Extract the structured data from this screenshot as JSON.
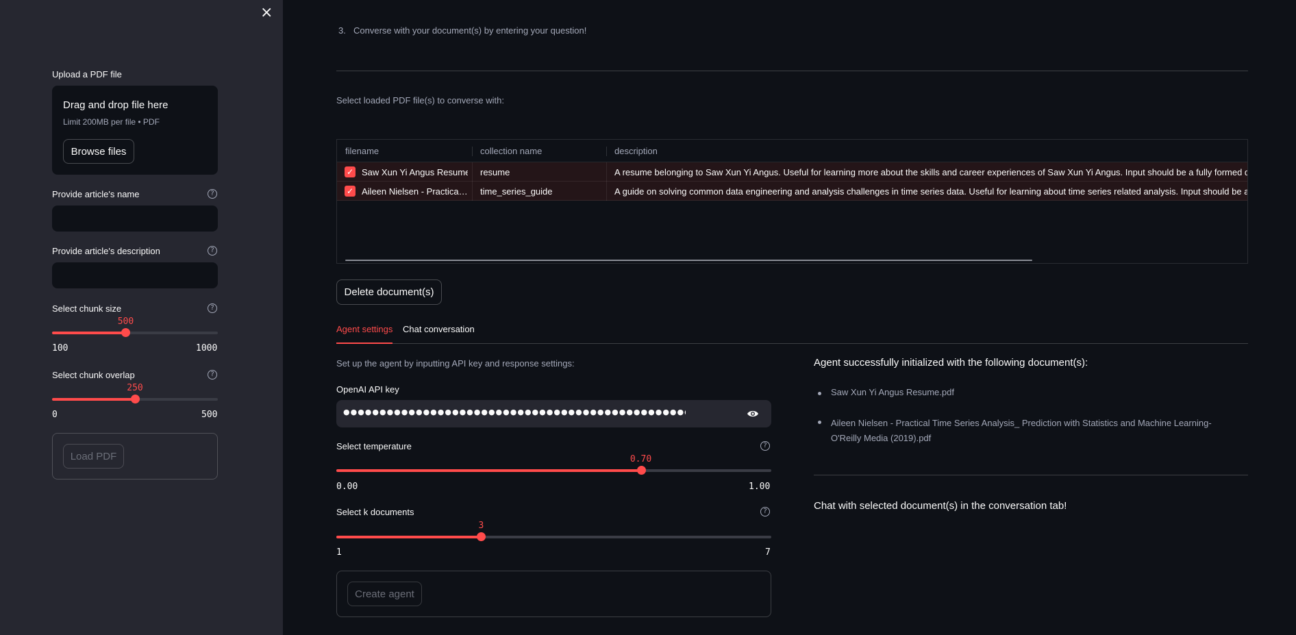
{
  "sidebar": {
    "close_icon": "×",
    "upload": {
      "label": "Upload a PDF file",
      "drop_title": "Drag and drop file here",
      "drop_hint": "Limit 200MB per file • PDF",
      "browse_label": "Browse files"
    },
    "article_name": {
      "label": "Provide article's name",
      "value": ""
    },
    "article_description": {
      "label": "Provide article's description",
      "value": ""
    },
    "chunk_size": {
      "label": "Select chunk size",
      "value": 500,
      "value_text": "500",
      "min": "100",
      "max": "1000",
      "fraction": 0.444
    },
    "chunk_overlap": {
      "label": "Select chunk overlap",
      "value": 250,
      "value_text": "250",
      "min": "0",
      "max": "500",
      "fraction": 0.5
    },
    "load_button": "Load PDF"
  },
  "main": {
    "step3_num": "3.",
    "step3_text": "Converse with your document(s) by entering your question!",
    "select_label": "Select loaded PDF file(s) to converse with:",
    "table": {
      "columns": [
        "filename",
        "collection name",
        "description"
      ],
      "rows": [
        {
          "checked": true,
          "filename": "Saw Xun Yi Angus Resume",
          "collection": "resume",
          "description": "A resume belonging to Saw Xun Yi Angus. Useful for learning more about the skills and career experiences of Saw Xun Yi Angus. Input should be a fully formed question."
        },
        {
          "checked": true,
          "filename": "Aileen Nielsen - Practica…",
          "collection": "time_series_guide",
          "description": "A guide on solving common data engineering and analysis challenges in time series data. Useful for learning about time series related analysis. Input should be a fully formed question."
        }
      ]
    },
    "delete_button": "Delete document(s)",
    "tabs": [
      {
        "label": "Agent settings",
        "active": true
      },
      {
        "label": "Chat conversation",
        "active": false
      }
    ],
    "settings": {
      "intro": "Set up the agent by inputting API key and response settings:",
      "api_key_label": "OpenAI API key",
      "api_key_masked": "●●●●●●●●●●●●●●●●●●●●●●●●●●●●●●●●●●●●●●●●●●●●●●●●●●●",
      "eye_icon": "eye-icon",
      "temperature": {
        "label": "Select temperature",
        "value": 0.7,
        "value_text": "0.70",
        "min": "0.00",
        "max": "1.00",
        "fraction": 0.7
      },
      "k_documents": {
        "label": "Select k documents",
        "value": 3,
        "value_text": "3",
        "min": "1",
        "max": "7",
        "fraction": 0.333
      },
      "create_button": "Create agent"
    },
    "status": {
      "title": "Agent successfully initialized with the following document(s):",
      "documents": [
        "Saw Xun Yi Angus Resume.pdf",
        "Aileen Nielsen - Practical Time Series Analysis_ Prediction with Statistics and Machine Learning-O'Reilly Media (2019).pdf"
      ],
      "chat_hint": "Chat with selected document(s) in the conversation tab!"
    }
  },
  "colors": {
    "accent": "#ff4b4b",
    "sidebar_bg": "#262730",
    "main_bg": "#0e1117"
  }
}
